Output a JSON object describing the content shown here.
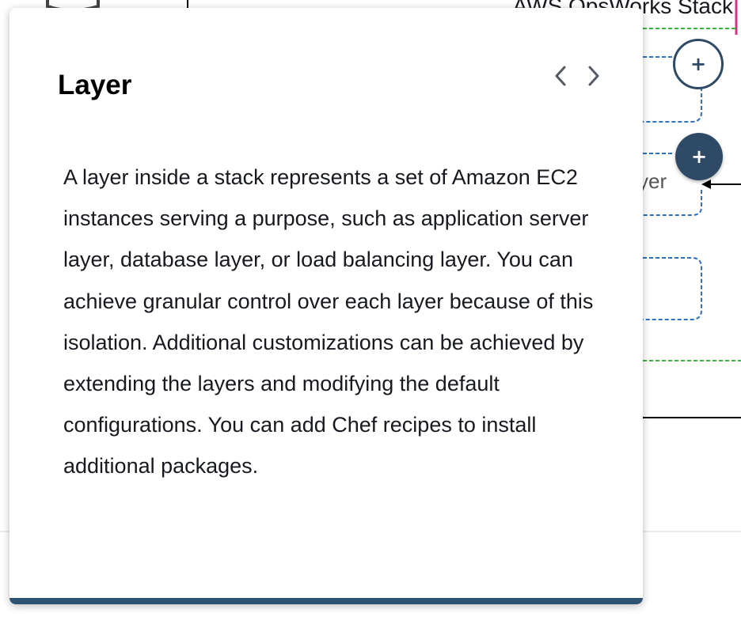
{
  "background": {
    "stack_title": "AWS OpsWorks Stack",
    "partial_layer_label": "yer",
    "add_buttons": [
      "+",
      "+"
    ]
  },
  "popover": {
    "title": "Layer",
    "prev_icon": "chevron-left-icon",
    "next_icon": "chevron-right-icon",
    "body": "A layer inside a stack represents a set of Amazon EC2 instances serving a purpose, such as application server layer, database layer, or load balancing layer. You can achieve granular control over each layer because of this isolation. Additional customizations can be achieved by extending the layers and modifying the default configurations. You can add Chef recipes to install additional packages."
  },
  "colors": {
    "accent": "#2e4a66",
    "bottom_bar": "#2e5272",
    "green_dashed": "#3cb043",
    "blue_dashed": "#2f6fbd"
  }
}
